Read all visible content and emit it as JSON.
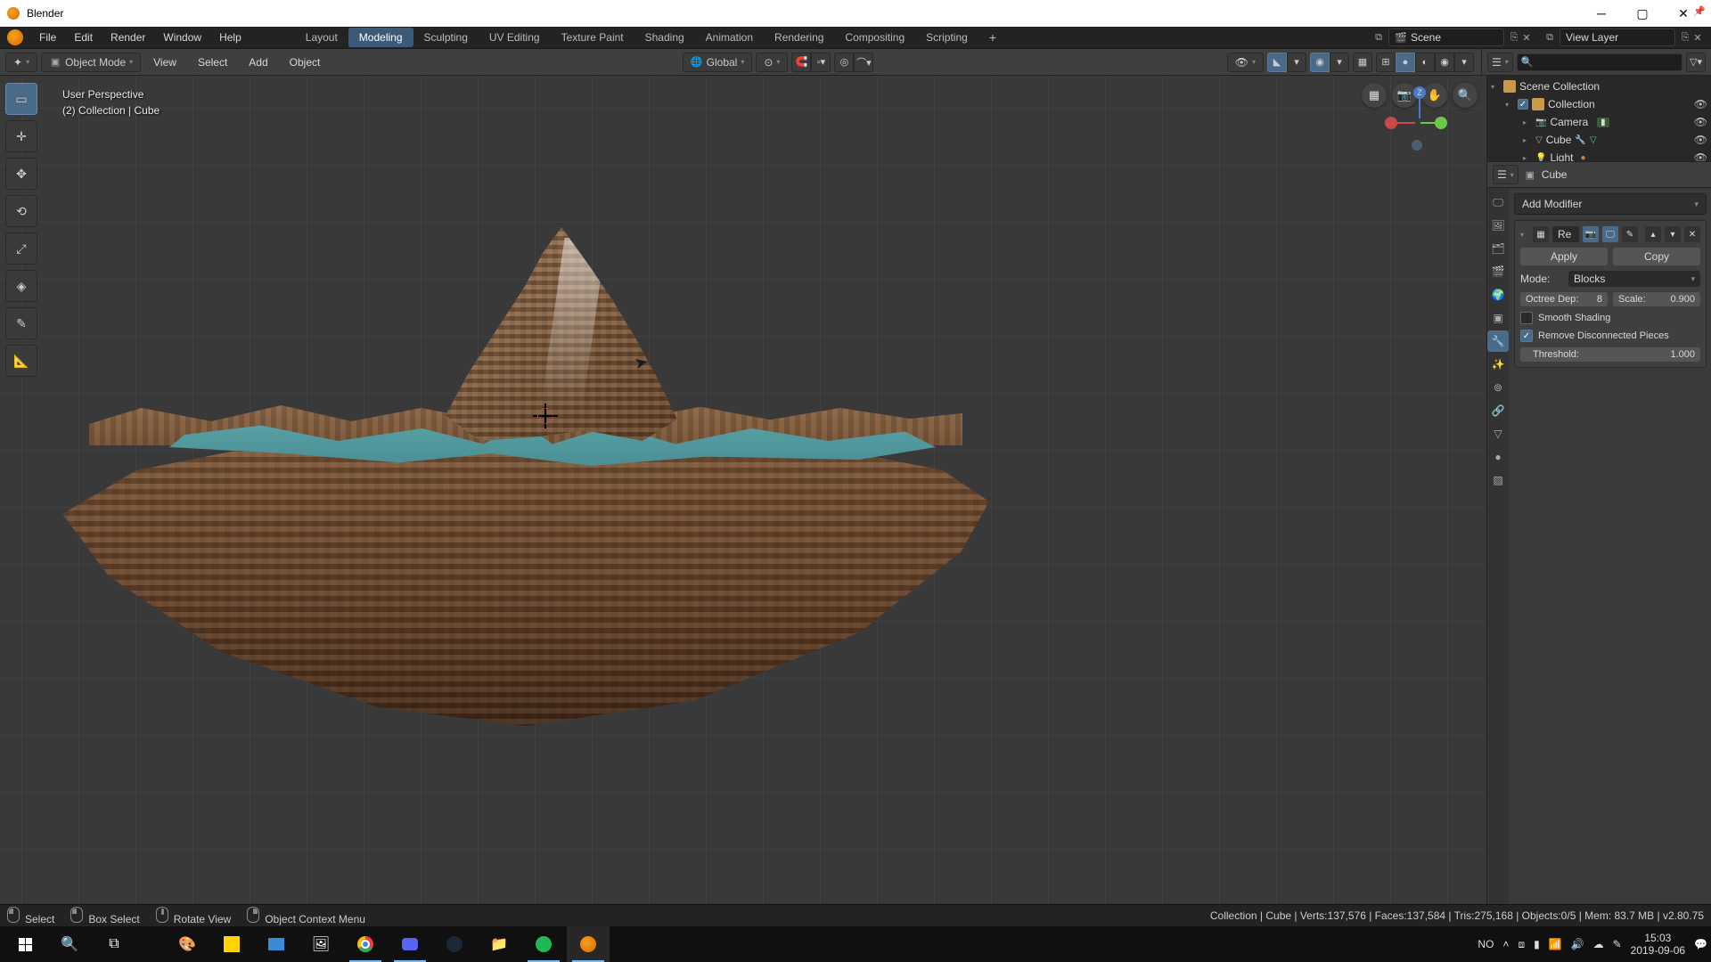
{
  "window": {
    "title": "Blender"
  },
  "menubar": {
    "items": [
      "File",
      "Edit",
      "Render",
      "Window",
      "Help"
    ],
    "workspaces": [
      "Layout",
      "Modeling",
      "Sculpting",
      "UV Editing",
      "Texture Paint",
      "Shading",
      "Animation",
      "Rendering",
      "Compositing",
      "Scripting"
    ],
    "active_workspace": "Modeling",
    "scene_label": "Scene",
    "view_layer_label": "View Layer"
  },
  "viewport_header": {
    "mode": "Object Mode",
    "menus": [
      "View",
      "Select",
      "Add",
      "Object"
    ],
    "orientation": "Global"
  },
  "viewport_overlay": {
    "line1": "User Perspective",
    "line2": "(2) Collection | Cube"
  },
  "outliner": {
    "root": "Scene Collection",
    "collection": "Collection",
    "items": [
      {
        "name": "Camera",
        "type": "camera"
      },
      {
        "name": "Cube",
        "type": "mesh",
        "has_modifier": true
      },
      {
        "name": "Light",
        "type": "light"
      }
    ],
    "search_placeholder": ""
  },
  "properties": {
    "context_object": "Cube",
    "add_modifier": "Add Modifier",
    "modifier": {
      "name": "Re",
      "apply": "Apply",
      "copy": "Copy",
      "mode_label": "Mode:",
      "mode_value": "Blocks",
      "octree_label": "Octree Dep:",
      "octree_value": "8",
      "scale_label": "Scale:",
      "scale_value": "0.900",
      "smooth_shading": "Smooth Shading",
      "remove_disconnected": "Remove Disconnected Pieces",
      "threshold_label": "Threshold:",
      "threshold_value": "1.000"
    }
  },
  "statusbar": {
    "select": "Select",
    "box_select": "Box Select",
    "rotate": "Rotate View",
    "context": "Object Context Menu",
    "stats": "Collection | Cube | Verts:137,576 | Faces:137,584 | Tris:275,168 | Objects:0/5 | Mem: 83.7 MB | v2.80.75"
  },
  "taskbar": {
    "lang": "NO",
    "time": "15:03",
    "date": "2019-09-06"
  }
}
